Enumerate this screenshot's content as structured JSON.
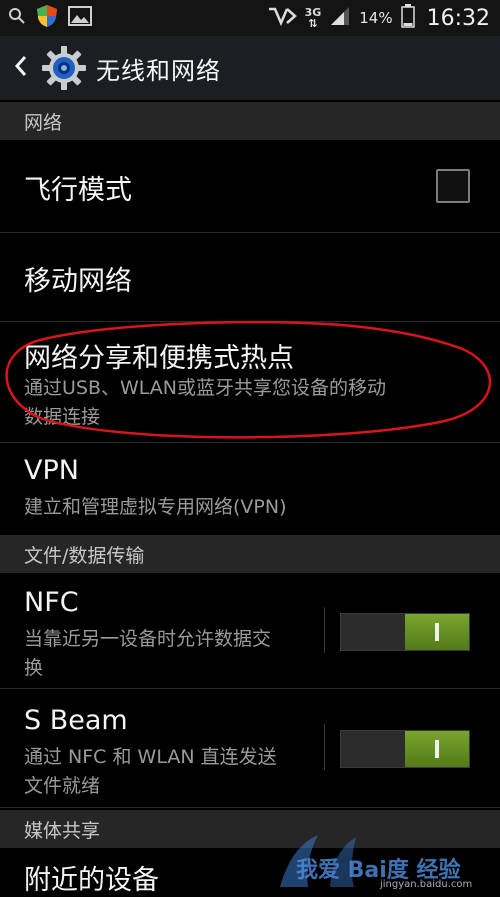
{
  "status_bar": {
    "network": "3G",
    "battery": "14%",
    "time": "16:32"
  },
  "action_bar": {
    "title": "无线和网络"
  },
  "sections": {
    "network": "网络",
    "file_transfer": "文件/数据传输",
    "media_share": "媒体共享"
  },
  "items": {
    "airplane": {
      "title": "飞行模式",
      "checked": false
    },
    "mobile_network": {
      "title": "移动网络"
    },
    "tethering": {
      "title": "网络分享和便携式热点",
      "sub_line1": "通过USB、WLAN或蓝牙共享您设备的移动",
      "sub_line2": "数据连接"
    },
    "vpn": {
      "title": "VPN",
      "sub": "建立和管理虚拟专用网络(VPN)"
    },
    "nfc": {
      "title": "NFC",
      "sub_line1": "当靠近另一设备时允许数据交",
      "sub_line2": "换",
      "enabled": true
    },
    "sbeam": {
      "title": "S Beam",
      "sub_line1": "通过 NFC 和 WLAN 直连发送",
      "sub_line2": "文件就绪",
      "enabled": true
    },
    "nearby": {
      "title": "附近的设备"
    }
  },
  "watermark": {
    "text": "我爱 Bai度 经验",
    "url": "jingyan.baidu.com"
  },
  "colors": {
    "accent_green": "#6b9a22",
    "annotation_red": "#d8141c",
    "section_bg": "#262626"
  }
}
